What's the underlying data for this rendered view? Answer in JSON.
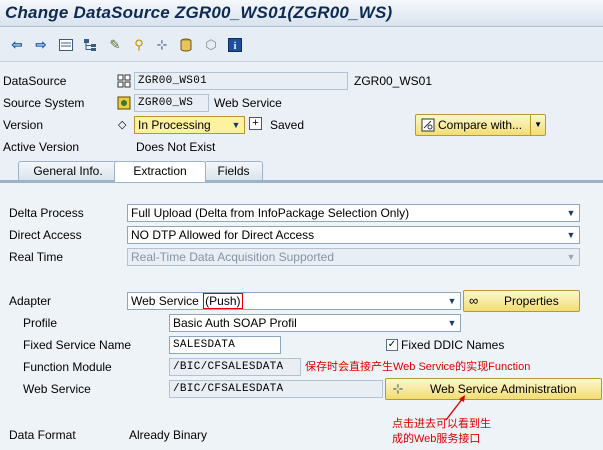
{
  "window": {
    "title": "Change DataSource ZGR00_WS01(ZGR00_WS)"
  },
  "toolbar": {
    "icons": [
      "back-icon",
      "forward-icon",
      "display-icon",
      "hierarchy-icon",
      "check-icon",
      "activate-icon",
      "where-used-icon",
      "database-icon",
      "object-icon",
      "info-icon"
    ]
  },
  "header": {
    "datasource": {
      "label": "DataSource",
      "value": "ZGR00_WS01",
      "desc": "ZGR00_WS01"
    },
    "source_system": {
      "label": "Source System",
      "value": "ZGR00_WS",
      "desc": "Web Service"
    },
    "version": {
      "label": "Version",
      "value": "In Processing",
      "status": "Saved"
    },
    "active_version": {
      "label": "Active Version",
      "value": "Does Not Exist"
    },
    "compare_button": "Compare with..."
  },
  "tabs": [
    {
      "label": "General Info."
    },
    {
      "label": "Extraction",
      "active": true
    },
    {
      "label": "Fields"
    }
  ],
  "extraction": {
    "delta_process": {
      "label": "Delta Process",
      "value": "Full Upload (Delta from InfoPackage Selection Only)"
    },
    "direct_access": {
      "label": "Direct Access",
      "value": "NO DTP Allowed for Direct Access"
    },
    "real_time": {
      "label": "Real Time",
      "value": "Real-Time Data Acquisition Supported"
    },
    "adapter": {
      "label": "Adapter",
      "value_prefix": "Web Service",
      "value_highlight": "(Push)",
      "button": "Properties"
    },
    "profile": {
      "label": "Profile",
      "value": "Basic Auth SOAP Profil"
    },
    "fixed_service_name": {
      "label": "Fixed Service Name",
      "value": "SALESDATA"
    },
    "fixed_ddic": {
      "label": "Fixed DDIC Names",
      "checked": true
    },
    "function_module": {
      "label": "Function Module",
      "value": "/BIC/CFSALESDATA"
    },
    "web_service": {
      "label": "Web Service",
      "value": "/BIC/CFSALESDATA",
      "button": "Web Service Administration"
    },
    "data_format": {
      "label": "Data Format",
      "value": "Already Binary"
    }
  },
  "annotations": {
    "note1": "保存时会直接产生Web Service的实现Function",
    "note2_line1": "点击进去可以看到生",
    "note2_line2": "成的Web服务接口"
  },
  "colors": {
    "title": "#0f2a52",
    "button": "#f1dd72",
    "annotation": "#e00000",
    "background": "#eaf0f6"
  }
}
